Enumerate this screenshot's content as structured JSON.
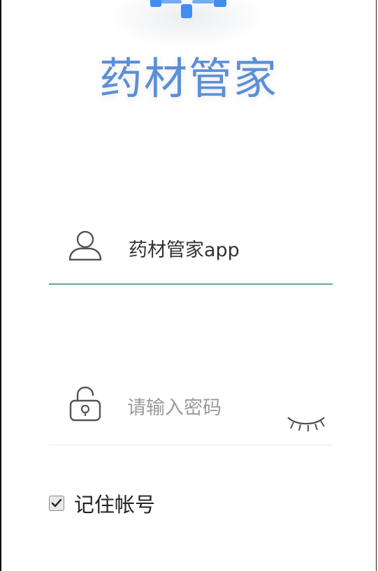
{
  "app": {
    "title": "药材管家"
  },
  "login": {
    "username_value": "药材管家app",
    "password_placeholder": "请输入密码",
    "remember_label": "记住帐号",
    "remember_checked": true
  },
  "colors": {
    "brand_blue": "#5b8fd6",
    "logo_blue": "#3f8df0",
    "active_underline": "#5fae91",
    "inactive_underline": "#e8e8e8"
  },
  "icons": {
    "username": "user-icon",
    "password": "lock-icon",
    "password_visibility": "eye-closed-icon",
    "remember": "checkbox-checked-icon"
  }
}
